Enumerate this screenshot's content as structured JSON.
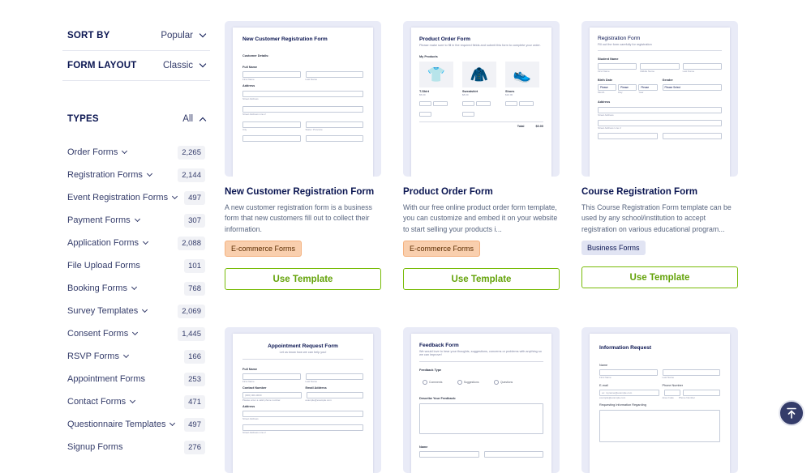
{
  "sidebar": {
    "sort_by": {
      "label": "SORT BY",
      "value": "Popular"
    },
    "form_layout": {
      "label": "FORM LAYOUT",
      "value": "Classic"
    },
    "types": {
      "label": "TYPES",
      "value": "All"
    },
    "type_items": [
      {
        "name": "Order Forms",
        "count": "2,265",
        "has_chevron": true
      },
      {
        "name": "Registration Forms",
        "count": "2,144",
        "has_chevron": true
      },
      {
        "name": "Event Registration Forms",
        "count": "497",
        "has_chevron": true
      },
      {
        "name": "Payment Forms",
        "count": "307",
        "has_chevron": true
      },
      {
        "name": "Application Forms",
        "count": "2,088",
        "has_chevron": true
      },
      {
        "name": "File Upload Forms",
        "count": "101",
        "has_chevron": false
      },
      {
        "name": "Booking Forms",
        "count": "768",
        "has_chevron": true
      },
      {
        "name": "Survey Templates",
        "count": "2,069",
        "has_chevron": true
      },
      {
        "name": "Consent Forms",
        "count": "1,445",
        "has_chevron": true
      },
      {
        "name": "RSVP Forms",
        "count": "166",
        "has_chevron": true
      },
      {
        "name": "Appointment Forms",
        "count": "253",
        "has_chevron": false
      },
      {
        "name": "Contact Forms",
        "count": "471",
        "has_chevron": true
      },
      {
        "name": "Questionnaire Templates",
        "count": "497",
        "has_chevron": true
      },
      {
        "name": "Signup Forms",
        "count": "276",
        "has_chevron": false
      }
    ]
  },
  "cards": [
    {
      "title": "New Customer Registration Form",
      "description": "A new customer registration form is a business form that new customers fill out to collect their information.",
      "badge": "E-commerce Forms",
      "button": "Use Template",
      "preview": {
        "title": "New Customer Registration Form",
        "section": "Customer Details:",
        "full_name": "Full Name",
        "first_name": "First Name",
        "last_name": "Last Name",
        "address": "Address",
        "street": "Street Address",
        "street2": "Street Address Line 2",
        "city": "City",
        "state": "State / Province"
      }
    },
    {
      "title": "Product Order Form",
      "description": "With our free online product order form template, you can customize and embed it on your website to start selling your products i...",
      "badge": "E-commerce Forms",
      "button": "Use Template",
      "preview": {
        "title": "Product Order Form",
        "sub": "Please make sure to fill in the required fields and submit this form to complete your order.",
        "my_products": "My Products",
        "products": [
          {
            "name": "T-Shirt",
            "price": "$5.00",
            "icon": "👕"
          },
          {
            "name": "Sweatshirt",
            "price": "$8.00",
            "icon": "🧥"
          },
          {
            "name": "Shoes",
            "price": "$10.00",
            "icon": "👟"
          }
        ],
        "total": "Total",
        "total_value": "$0.00"
      }
    },
    {
      "title": "Course Registration Form",
      "description": "This Course Registration Form template can be used by any school/institution to accept registration on various educational program...",
      "badge": "Business Forms",
      "button": "Use Template",
      "preview": {
        "title": "Registration Form",
        "sub": "Fill out the form carefully for registration",
        "student_name": "Student Name",
        "first_name": "First Name",
        "middle_name": "Middle Name",
        "last_name": "Last Name",
        "birth_date": "Birth Date",
        "gender": "Gender",
        "please_select": "Please Select",
        "month": "Month",
        "day": "Day",
        "year": "Year",
        "please": "Please",
        "address": "Address",
        "street": "Street Address",
        "street2": "Street Address Line 2"
      }
    },
    {
      "title": "Appointment Request Form",
      "preview": {
        "title": "Appointment Request Form",
        "sub": "Let us know how we can help you!",
        "full_name": "Full Name",
        "first_name": "First Name",
        "last_name": "Last Name",
        "contact": "Contact Number",
        "email": "Email Address",
        "phone_ph": "(000) 000-0000",
        "phone_help": "Please enter a valid phone number.",
        "email_ph": "example@example.com",
        "address": "Address",
        "street": "Street Address",
        "street2": "Street Address Line 2"
      }
    },
    {
      "title": "Feedback Form",
      "preview": {
        "title": "Feedback Form",
        "sub": "We would love to hear your thoughts, suggestions, concerns or problems with anything so we can improve!",
        "type": "Feedback Type",
        "options": [
          "Comments",
          "Suggestions",
          "Questions"
        ],
        "describe": "Describe Your Feedback:",
        "name": "Name"
      }
    },
    {
      "title": "Information Request",
      "preview": {
        "title": "Information Request",
        "name": "Name",
        "first_name": "First Name",
        "last_name": "Last Name",
        "email": "E-mail",
        "phone": "Phone Number",
        "email_ph": "ex: myname@example.com",
        "email_help": "example@example.com",
        "area_code": "Area Code",
        "phone_number": "Phone Number",
        "requesting": "Requesting Information Regarding"
      }
    }
  ],
  "scroll_top": {
    "icon": "arrow-up-to-line-icon"
  },
  "colors": {
    "accent": "#78bb07",
    "navy": "#0a1551",
    "badge_ecom": "#f9cfae",
    "badge_biz": "#e1e4f3"
  }
}
